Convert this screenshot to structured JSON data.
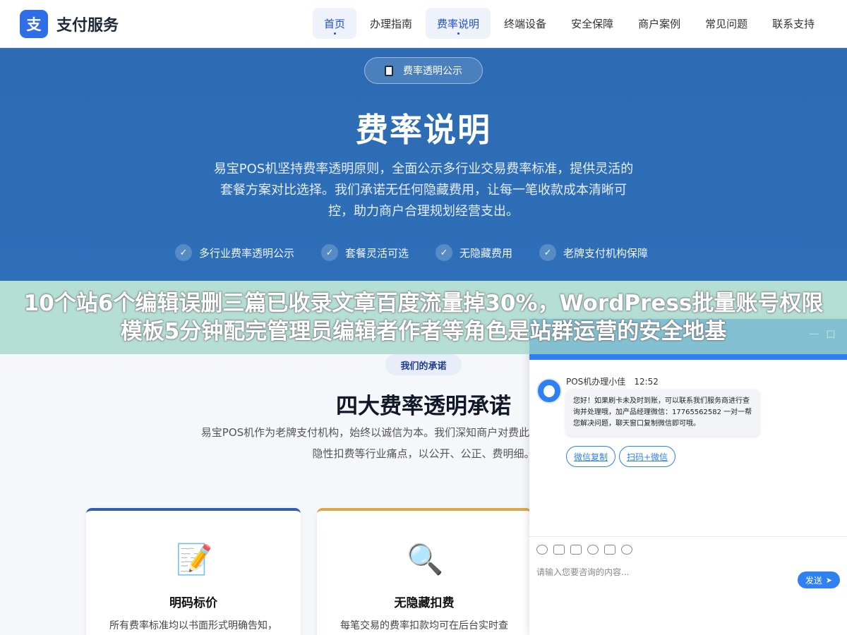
{
  "header": {
    "logo_mark": "支",
    "logo_text": "支付服务",
    "nav": [
      "首页",
      "办理指南",
      "费率说明",
      "终端设备",
      "安全保障",
      "商户案例",
      "常见问题",
      "联系支持"
    ]
  },
  "hero": {
    "badge": "费率透明公示",
    "title": "费率说明",
    "desc": "易宝POS机坚持费率透明原则，全面公示多行业交易费率标准，提供灵活的套餐方案对比选择。我们承诺无任何隐藏费用，让每一笔收款成本清晰可控，助力商户合理规划经营支出。",
    "features": [
      "多行业费率透明公示",
      "套餐灵活可选",
      "无隐藏费用",
      "老牌支付机构保障"
    ]
  },
  "overlay": {
    "text": "10个站6个编辑误删三篇已收录文章百度流量掉30%，WordPress批量账号权限模板5分钟配完管理员编辑者作者等角色是站群运营的安全地基"
  },
  "section": {
    "tag": "我们的承诺",
    "title": "四大费率透明承诺",
    "desc": "易宝POS机作为老牌支付机构，始终以诚信为本。我们深知商户对费此从根源上杜绝模糊定价、隐性扣费等行业痛点，以公开、公正、费明细。",
    "cards": [
      {
        "icon": "memo-icon",
        "glyph": "📝",
        "title": "明码标价",
        "desc": "所有费率标准均以书面形式明确告知，"
      },
      {
        "icon": "magnifier-icon",
        "glyph": "🔍",
        "title": "无隐藏扣费",
        "desc": "每笔交易的费率扣款均可在后台实时查"
      }
    ]
  },
  "chat": {
    "minimize": "一",
    "maximize": "口",
    "agent_name": "POS机办理小佳",
    "time": "12:52",
    "message": "您好！如果刷卡未及时到账，可以联系我们服务商进行查询并处理哦，加产品经理微信：17765562582 一对一帮您解决问题，聊天窗口复制微信即可哦。",
    "quick_replies": [
      "微信复制",
      "扫码+微信"
    ],
    "input_placeholder": "请输入您要咨询的内容...",
    "send_label": "发送"
  },
  "colors": {
    "brand_blue": "#2f6ee6",
    "hero_blue": "#2e6fb8",
    "chat_blue": "#2f80f0",
    "card_orange": "#e3a347"
  }
}
